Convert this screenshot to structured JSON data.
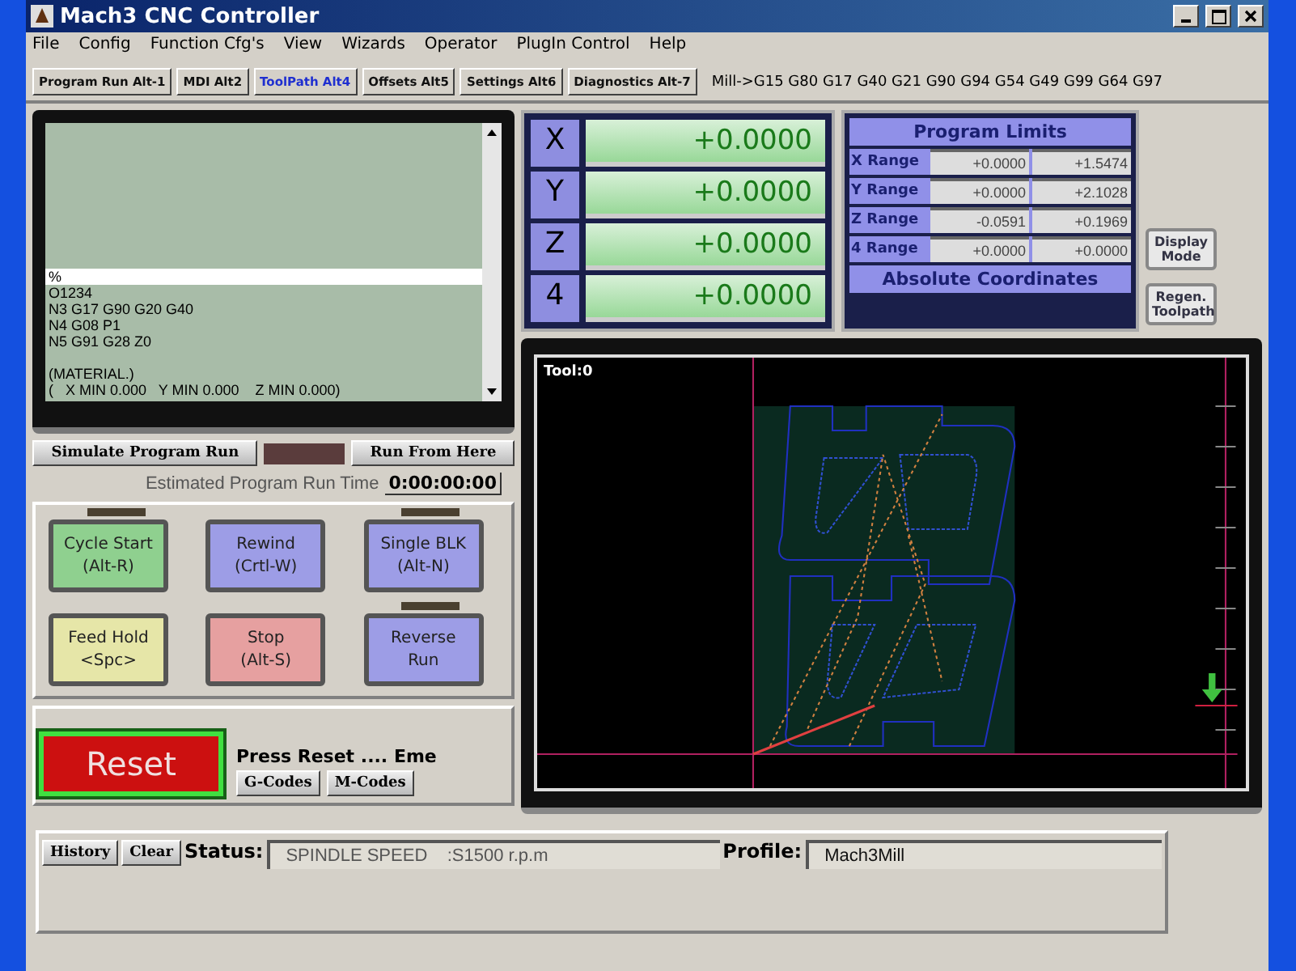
{
  "window": {
    "title": "Mach3 CNC Controller"
  },
  "menu": [
    "File",
    "Config",
    "Function Cfg's",
    "View",
    "Wizards",
    "Operator",
    "PlugIn Control",
    "Help"
  ],
  "tabs": [
    {
      "label": "Program Run Alt-1",
      "selected": false
    },
    {
      "label": "MDI Alt2",
      "selected": false
    },
    {
      "label": "ToolPath Alt4",
      "selected": true
    },
    {
      "label": "Offsets Alt5",
      "selected": false
    },
    {
      "label": "Settings Alt6",
      "selected": false
    },
    {
      "label": "Diagnostics Alt-7",
      "selected": false
    }
  ],
  "modal_codes": "Mill->G15  G80 G17 G40 G21 G90 G94 G54 G49 G99 G64 G97",
  "gcode_lines": [
    {
      "text": "%",
      "selected": true,
      "blank_before": false
    },
    {
      "text": "O1234",
      "selected": false,
      "blank_before": false
    },
    {
      "text": "N3 G17 G90 G20 G40",
      "selected": false,
      "blank_before": false
    },
    {
      "text": "N4 G08 P1",
      "selected": false,
      "blank_before": false
    },
    {
      "text": "N5 G91 G28 Z0",
      "selected": false,
      "blank_before": false
    },
    {
      "text": "(MATERIAL.)",
      "selected": false,
      "blank_before": true
    },
    {
      "text": "(   X MIN 0.000   Y MIN 0.000    Z MIN 0.000)",
      "selected": false,
      "blank_before": false
    }
  ],
  "program_controls": {
    "simulate": "Simulate Program Run",
    "run_from_here": "Run From Here",
    "est_label": "Estimated Program Run Time",
    "est_value": "0:00:00:00"
  },
  "axes": [
    {
      "label": "X",
      "value": "+0.0000"
    },
    {
      "label": "Y",
      "value": "+0.0000"
    },
    {
      "label": "Z",
      "value": "+0.0000"
    },
    {
      "label": "4",
      "value": "+0.0000"
    }
  ],
  "limits": {
    "title": "Program Limits",
    "rows": [
      {
        "label": "X Range",
        "min": "+0.0000",
        "max": "+1.5474"
      },
      {
        "label": "Y Range",
        "min": "+0.0000",
        "max": "+2.1028"
      },
      {
        "label": "Z Range",
        "min": "-0.0591",
        "max": "+0.1969"
      },
      {
        "label": "4 Range",
        "min": "+0.0000",
        "max": "+0.0000"
      }
    ],
    "mode": "Absolute Coordinates"
  },
  "side_buttons": [
    "Display Mode",
    "Regen. Toolpath"
  ],
  "cycle_buttons": [
    {
      "label": "Cycle Start",
      "shortcut": "(Alt-R)",
      "color": "#8fd08f",
      "led_on": false
    },
    {
      "label": "Rewind",
      "shortcut": "(Crtl-W)",
      "color": "#9d9de6"
    },
    {
      "label": "Single BLK",
      "shortcut": "(Alt-N)",
      "color": "#9d9de6",
      "led_on": false
    },
    {
      "label": "Feed Hold",
      "shortcut": "<Spc>",
      "color": "#e6e6a8"
    },
    {
      "label": "Stop",
      "shortcut": "(Alt-S)",
      "color": "#e6a0a0"
    },
    {
      "label": "Reverse",
      "shortcut": "Run",
      "color": "#9d9de6",
      "led_on": false
    }
  ],
  "reset": {
    "label": "Reset",
    "message": "Press Reset .... Eme",
    "buttons": [
      "G-Codes",
      "M-Codes"
    ]
  },
  "toolpath": {
    "tool_label": "Tool:0"
  },
  "status": {
    "history": "History",
    "clear": "Clear",
    "status_label": "Status:",
    "status_value": "SPINDLE SPEED    :S1500 r.p.m",
    "profile_label": "Profile:",
    "profile_value": "Mach3Mill"
  }
}
